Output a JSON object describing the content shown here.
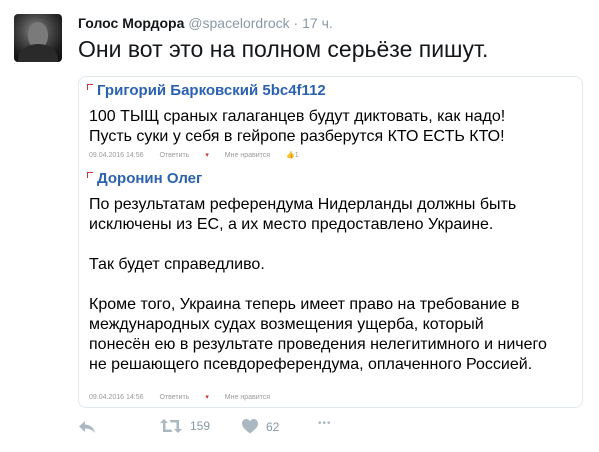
{
  "tweet": {
    "author_name": "Голос Мордора",
    "author_handle": "@spacelordrock",
    "separator": "·",
    "time": "17 ч.",
    "text": "Они вот это на полном серьёзе пишут."
  },
  "card": {
    "comments": [
      {
        "author": "Григорий Барковский 5bc4f112",
        "lines": [
          "100 ТЫЩ сраных галаганцев будут диктовать, как надо!",
          "Пусть суки у себя в гейропе разберутся КТО ЕСТЬ КТО!"
        ],
        "date": "09.04.2016 14:56",
        "reply": "Ответить",
        "like": "Мне нравится",
        "like_count": "1"
      },
      {
        "author": "Доронин Олег",
        "para1": [
          "По результатам референдума Нидерланды должны быть",
          "исключены из ЕС, а их место предоставлено Украине."
        ],
        "para2": [
          "Так будет справедливо."
        ],
        "para3": [
          "Кроме того, Украина теперь имеет право на требование в",
          "международных судах возмещения ущерба, который",
          "понесён ею в результате проведения нелегитимного и ничего",
          "не решающего псевдореферендума, оплаченного Россией."
        ],
        "date": "09.04.2016 14:56",
        "reply": "Ответить",
        "like": "Мне нравится"
      }
    ]
  },
  "actions": {
    "reply_icon": "reply-icon",
    "retweet_icon": "retweet-icon",
    "retweet_count": "159",
    "like_icon": "heart-icon",
    "like_count": "62",
    "more_icon": "more-icon",
    "more_label": "•••"
  }
}
